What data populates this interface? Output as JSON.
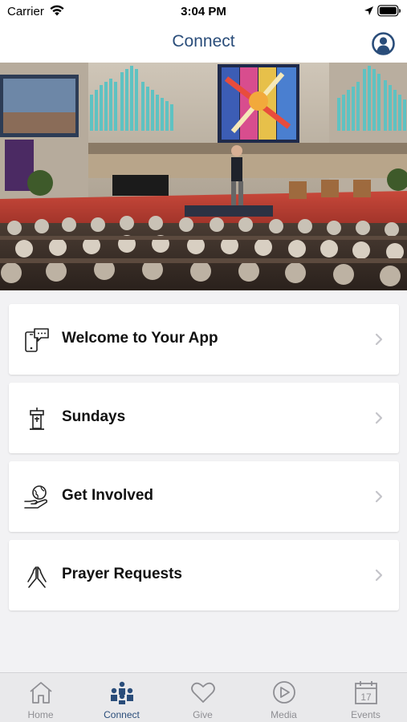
{
  "status_bar": {
    "carrier": "Carrier",
    "time": "3:04 PM"
  },
  "nav": {
    "title": "Connect"
  },
  "colors": {
    "accent": "#2a4d7a",
    "inactive": "#8e8e93",
    "card_background": "#ffffff",
    "page_background": "#f2f2f4"
  },
  "hero": {
    "icon": "church-sanctuary-photo"
  },
  "cards": [
    {
      "label": "Welcome to Your App",
      "icon": "phone-chat-icon"
    },
    {
      "label": "Sundays",
      "icon": "pulpit-icon"
    },
    {
      "label": "Get Involved",
      "icon": "globe-hand-icon"
    },
    {
      "label": "Prayer Requests",
      "icon": "praying-hands-icon"
    }
  ],
  "tabs": [
    {
      "label": "Home",
      "icon": "home-icon",
      "active": false
    },
    {
      "label": "Connect",
      "icon": "people-icon",
      "active": true
    },
    {
      "label": "Give",
      "icon": "heart-icon",
      "active": false
    },
    {
      "label": "Media",
      "icon": "play-icon",
      "active": false
    },
    {
      "label": "Events",
      "icon": "calendar-icon",
      "active": false,
      "day": "17"
    }
  ]
}
